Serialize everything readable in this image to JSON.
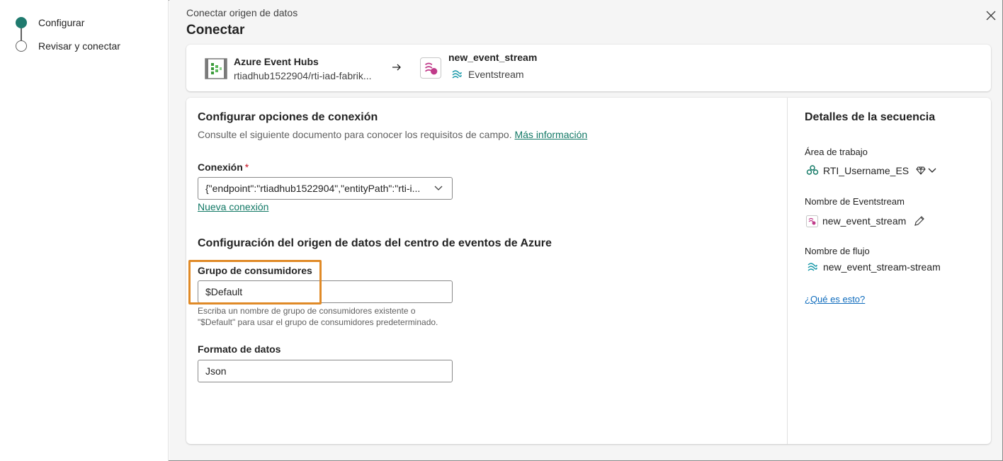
{
  "stepper": {
    "steps": [
      {
        "label": "Configurar"
      },
      {
        "label": "Revisar y conectar"
      }
    ]
  },
  "header": {
    "breadcrumb": "Conectar origen de datos",
    "title": "Conectar"
  },
  "connection_summary": {
    "source_name": "Azure Event Hubs",
    "source_detail": "rtiadhub1522904/rti-iad-fabrik...",
    "destination_name": "new_event_stream",
    "destination_type": "Eventstream"
  },
  "form": {
    "section1_title": "Configurar opciones de conexión",
    "section1_desc": "Consulte el siguiente documento para conocer los requisitos de campo.",
    "more_info_link": "Más información",
    "connection_label": "Conexión",
    "required_mark": "*",
    "connection_value": "{\"endpoint\":\"rtiadhub1522904\",\"entityPath\":\"rti-i...",
    "new_connection_link": "Nueva conexión",
    "section2_title": "Configuración del origen de datos del centro de eventos de Azure",
    "consumer_group_label": "Grupo de consumidores",
    "consumer_group_value": "$Default",
    "consumer_group_hint_line1": "Escriba un nombre de grupo de consumidores existente o",
    "consumer_group_hint_line2": "\"$Default\" para usar el grupo de consumidores predeterminado.",
    "data_format_label": "Formato de datos",
    "data_format_value": "Json"
  },
  "details": {
    "title": "Detalles de la secuencia",
    "workspace_label": "Área de trabajo",
    "workspace_value": "RTI_Username_ES",
    "eventstream_label": "Nombre de Eventstream",
    "eventstream_value": "new_event_stream",
    "stream_label": "Nombre de flujo",
    "stream_value": "new_event_stream-stream",
    "help_link": "¿Qué es esto?"
  },
  "colors": {
    "accent_teal": "#1f7a6e",
    "highlight_orange": "#e08a27",
    "eventstream_pink": "#c03b8a"
  }
}
